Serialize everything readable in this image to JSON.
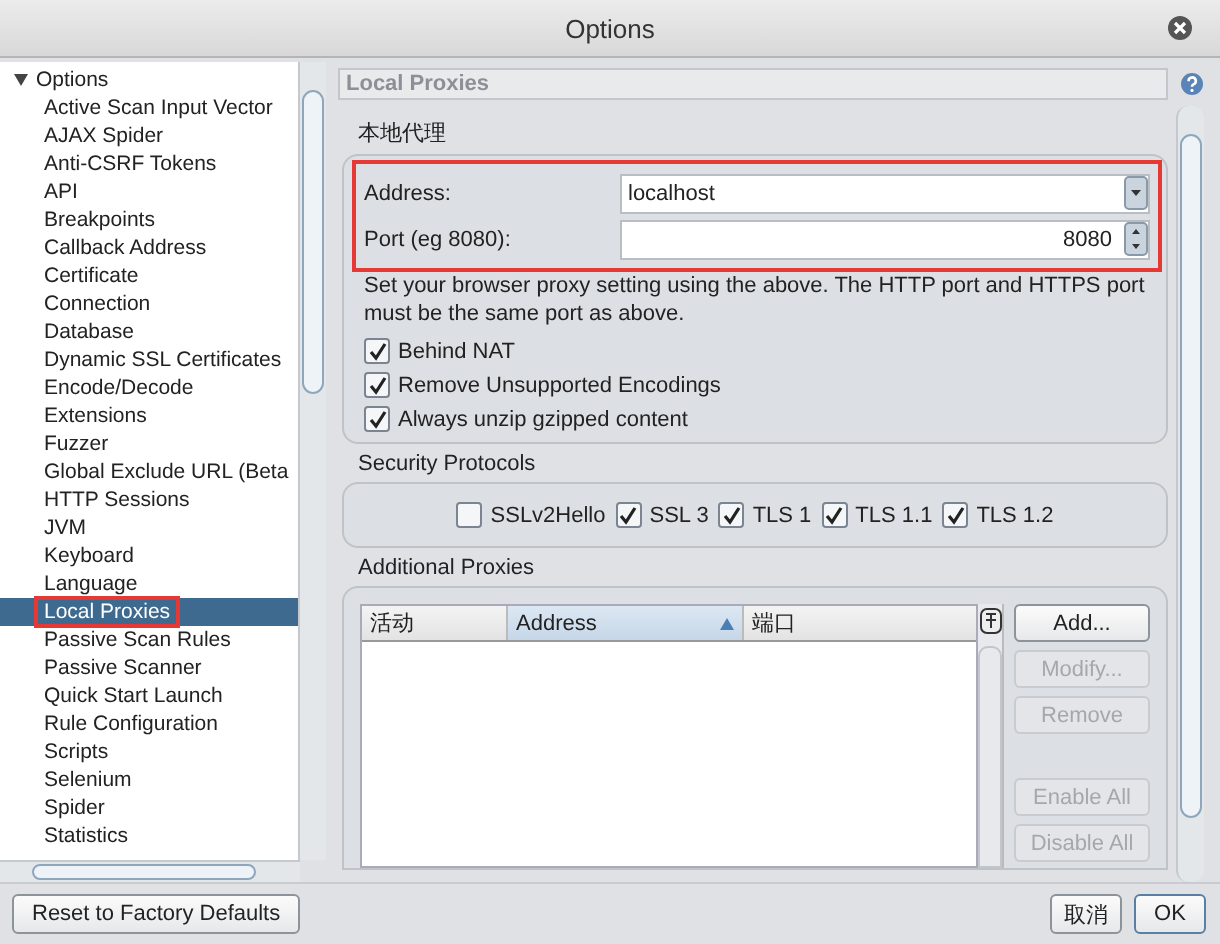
{
  "window": {
    "title": "Options"
  },
  "tree": {
    "label": "Options",
    "expanded": true,
    "children": [
      {
        "label": "Active Scan Input Vector",
        "selected": false,
        "highlighted": false
      },
      {
        "label": "AJAX Spider",
        "selected": false,
        "highlighted": false
      },
      {
        "label": "Anti-CSRF Tokens",
        "selected": false,
        "highlighted": false
      },
      {
        "label": "API",
        "selected": false,
        "highlighted": false
      },
      {
        "label": "Breakpoints",
        "selected": false,
        "highlighted": false
      },
      {
        "label": "Callback Address",
        "selected": false,
        "highlighted": false
      },
      {
        "label": "Certificate",
        "selected": false,
        "highlighted": false
      },
      {
        "label": "Connection",
        "selected": false,
        "highlighted": false
      },
      {
        "label": "Database",
        "selected": false,
        "highlighted": false
      },
      {
        "label": "Dynamic SSL Certificates",
        "selected": false,
        "highlighted": false
      },
      {
        "label": "Encode/Decode",
        "selected": false,
        "highlighted": false
      },
      {
        "label": "Extensions",
        "selected": false,
        "highlighted": false
      },
      {
        "label": "Fuzzer",
        "selected": false,
        "highlighted": false
      },
      {
        "label": "Global Exclude URL (Beta",
        "selected": false,
        "highlighted": false
      },
      {
        "label": "HTTP Sessions",
        "selected": false,
        "highlighted": false
      },
      {
        "label": "JVM",
        "selected": false,
        "highlighted": false
      },
      {
        "label": "Keyboard",
        "selected": false,
        "highlighted": false
      },
      {
        "label": "Language",
        "selected": false,
        "highlighted": false
      },
      {
        "label": "Local Proxies",
        "selected": true,
        "highlighted": true
      },
      {
        "label": "Passive Scan Rules",
        "selected": false,
        "highlighted": false
      },
      {
        "label": "Passive Scanner",
        "selected": false,
        "highlighted": false
      },
      {
        "label": "Quick Start Launch",
        "selected": false,
        "highlighted": false
      },
      {
        "label": "Rule Configuration",
        "selected": false,
        "highlighted": false
      },
      {
        "label": "Scripts",
        "selected": false,
        "highlighted": false
      },
      {
        "label": "Selenium",
        "selected": false,
        "highlighted": false
      },
      {
        "label": "Spider",
        "selected": false,
        "highlighted": false
      },
      {
        "label": "Statistics",
        "selected": false,
        "highlighted": false
      }
    ]
  },
  "panel": {
    "header": "Local Proxies",
    "section": "本地代理",
    "proxy": {
      "highlighted": true,
      "address_label": "Address:",
      "address_value": "localhost",
      "port_label": "Port (eg 8080):",
      "port_value": "8080"
    },
    "note": "Set your browser proxy setting using the above.  The HTTP port and HTTPS port must be the same port as above.",
    "options": [
      {
        "label": "Behind NAT",
        "checked": true
      },
      {
        "label": "Remove Unsupported Encodings",
        "checked": true
      },
      {
        "label": "Always unzip gzipped content",
        "checked": true
      }
    ],
    "security_title": "Security Protocols",
    "protocols": [
      {
        "label": "SSLv2Hello",
        "checked": false
      },
      {
        "label": "SSL 3",
        "checked": true
      },
      {
        "label": "TLS 1",
        "checked": true
      },
      {
        "label": "TLS 1.1",
        "checked": true
      },
      {
        "label": "TLS 1.2",
        "checked": true
      }
    ],
    "additional_title": "Additional Proxies",
    "columns": [
      {
        "label": "活动",
        "sorted": false
      },
      {
        "label": "Address",
        "sorted": true
      },
      {
        "label": "端口",
        "sorted": false
      }
    ],
    "buttons": [
      {
        "label": "Add...",
        "disabled": false,
        "kind": "button"
      },
      {
        "label": "Modify...",
        "disabled": true,
        "kind": "button"
      },
      {
        "label": "Remove",
        "disabled": true,
        "kind": "button"
      },
      {
        "kind": "gap"
      },
      {
        "label": "Enable All",
        "disabled": true,
        "kind": "button"
      },
      {
        "label": "Disable All",
        "disabled": true,
        "kind": "button"
      }
    ]
  },
  "footer": {
    "reset": "Reset to Factory Defaults",
    "cancel": "取消",
    "ok": "OK"
  }
}
